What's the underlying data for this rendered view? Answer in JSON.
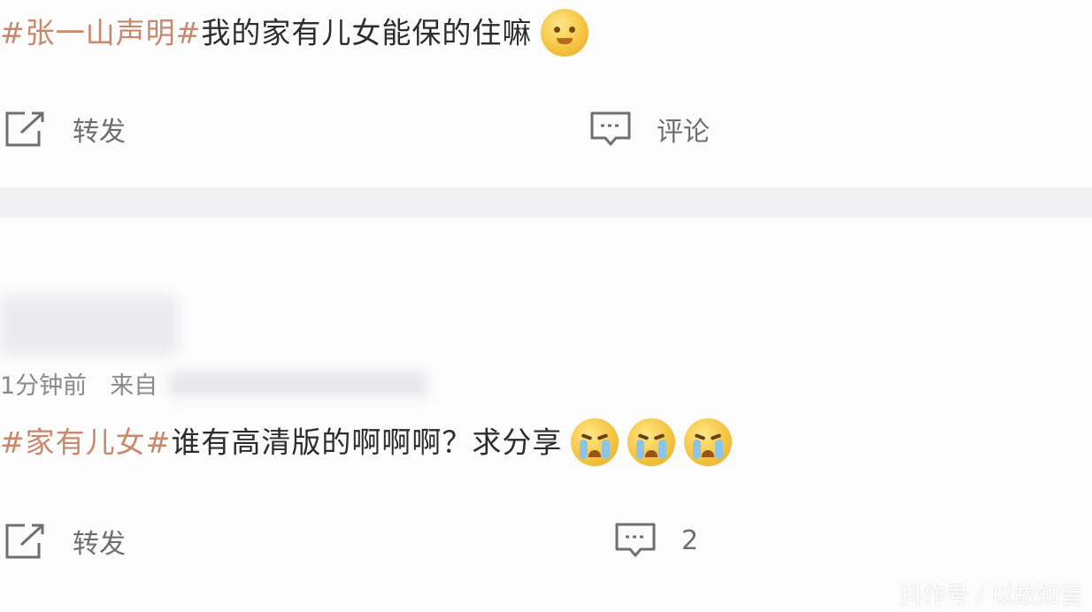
{
  "posts": [
    {
      "hashtag": "#张一山声明#",
      "text": "我的家有儿女能保的住嘛",
      "emoji": [
        "happy-emoji"
      ],
      "actions": {
        "repost_label": "转发",
        "comment_label": "评论"
      }
    },
    {
      "meta": {
        "time": "1分钟前",
        "source_prefix": "来自"
      },
      "hashtag": "#家有儿女#",
      "text": "谁有高清版的啊啊啊？求分享",
      "emoji": [
        "crying-emoji",
        "crying-emoji",
        "crying-emoji"
      ],
      "actions": {
        "repost_label": "转发",
        "comment_count": "2"
      }
    }
  ],
  "watermark": "抖作号 / 以故知音",
  "colors": {
    "hashtag": "#c9876b",
    "action_text": "#6f6f72",
    "divider": "#f0f0f3"
  }
}
